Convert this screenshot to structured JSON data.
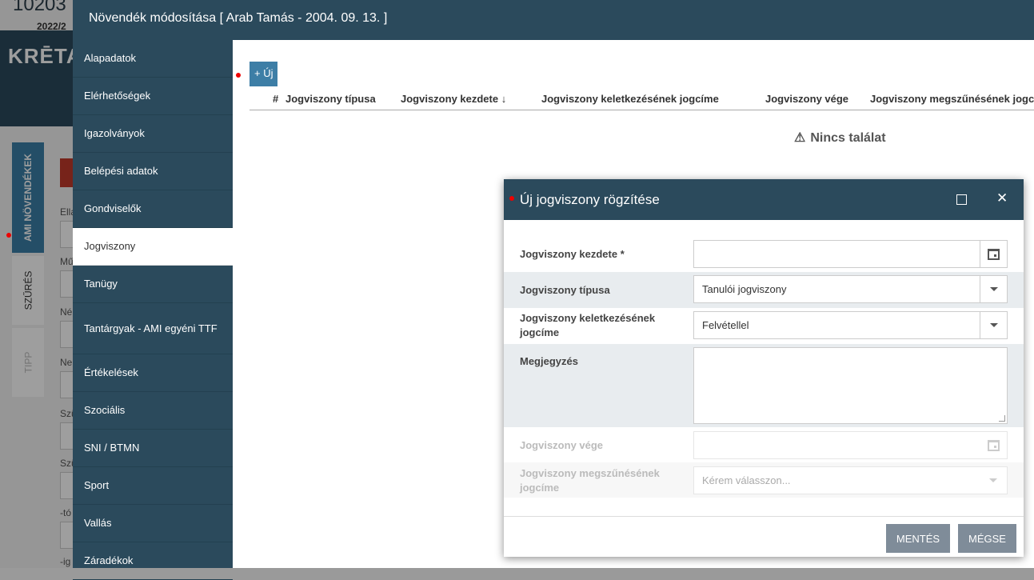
{
  "background": {
    "top_number": "10203",
    "year": "2022/2",
    "logo": "KRĒTA",
    "vtabs": [
      "AMI NÖVENDÉKEK",
      "SZŰRÉS",
      "TIPP"
    ],
    "labels": [
      "Ella",
      "Mű",
      "Né",
      "Ne",
      "Szü",
      "Szü",
      "-tó",
      "-ig"
    ]
  },
  "window": {
    "title": "Növendék módosítása [ Arab Tamás - 2004. 09. 13. ]"
  },
  "sidebar": {
    "items": [
      {
        "label": "Alapadatok"
      },
      {
        "label": "Elérhetőségek"
      },
      {
        "label": "Igazolványok"
      },
      {
        "label": "Belépési adatok"
      },
      {
        "label": "Gondviselők"
      },
      {
        "label": "Jogviszony"
      },
      {
        "label": "Tanügy"
      },
      {
        "label": "Tantárgyak - AMI egyéni TTF"
      },
      {
        "label": "Értékelések"
      },
      {
        "label": "Szociális"
      },
      {
        "label": "SNI / BTMN"
      },
      {
        "label": "Sport"
      },
      {
        "label": "Vallás"
      },
      {
        "label": "Záradékok"
      }
    ],
    "active_index": 5
  },
  "content": {
    "new_button_label": "+ Új",
    "grid_columns": [
      "#",
      "Jogviszony típusa",
      "Jogviszony kezdete ↓",
      "Jogviszony keletkezésének jogcíme",
      "Jogviszony vége",
      "Jogviszony megszűnésének jogcím"
    ],
    "empty_text": "Nincs találat",
    "warn_icon": "⚠"
  },
  "dialog": {
    "title": "Új jogviszony rögzítése",
    "max_icon": "maximize-icon",
    "close_icon": "✕",
    "fields": {
      "start_label": "Jogviszony kezdete *",
      "start_value": "",
      "type_label": "Jogviszony típusa",
      "type_value": "Tanulói jogviszony",
      "origin_label": "Jogviszony keletkezésének jogcíme",
      "origin_value": "Felvétellel",
      "note_label": "Megjegyzés",
      "note_value": "",
      "end_label": "Jogviszony vége",
      "end_value": "",
      "end_reason_label": "Jogviszony megszűnésének jogcíme",
      "end_reason_placeholder": "Kérem válasszon..."
    },
    "save_label": "MENTÉS",
    "cancel_label": "MÉGSE"
  },
  "colors": {
    "header": "#2b4a5c",
    "accent": "#3d7ea6",
    "button": "#7f8c99"
  }
}
